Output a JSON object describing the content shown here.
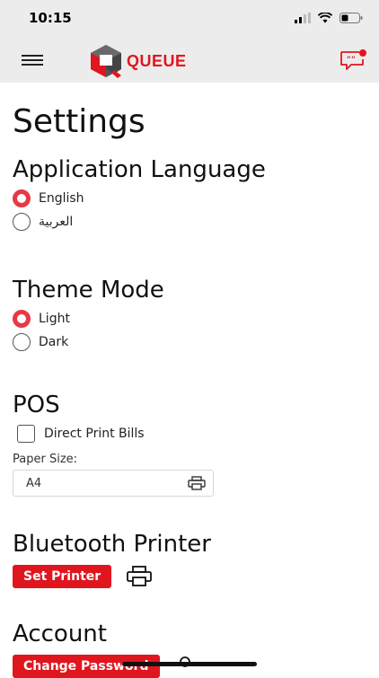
{
  "status": {
    "time": "10:15"
  },
  "brand": {
    "name": "QUEUE",
    "color": "#e0161f"
  },
  "page": {
    "title": "Settings"
  },
  "language": {
    "title": "Application Language",
    "options": [
      {
        "label": "English",
        "selected": true
      },
      {
        "label": "العربية",
        "selected": false
      }
    ]
  },
  "theme": {
    "title": "Theme Mode",
    "options": [
      {
        "label": "Light",
        "selected": true
      },
      {
        "label": "Dark",
        "selected": false
      }
    ]
  },
  "pos": {
    "title": "POS",
    "direct_print_label": "Direct Print Bills",
    "direct_print_checked": false,
    "paper_size_label": "Paper Size:",
    "paper_size_value": "A4"
  },
  "bluetooth": {
    "title": "Bluetooth Printer",
    "set_printer_label": "Set Printer"
  },
  "account": {
    "title": "Account",
    "change_password_label": "Change Password"
  },
  "colors": {
    "accent": "#e63946",
    "header_bg": "#ececec"
  }
}
